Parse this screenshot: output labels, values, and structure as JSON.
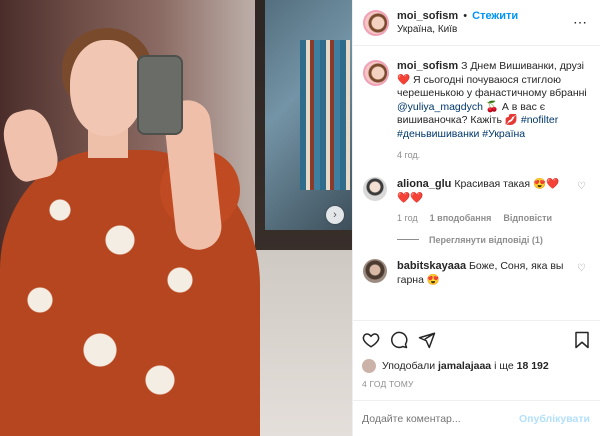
{
  "header": {
    "username": "moi_sofism",
    "separator": "•",
    "follow_label": "Стежити",
    "location": "Україна, Київ",
    "more_icon": "⋯"
  },
  "caption": {
    "username": "moi_sofism",
    "text_1": "З Днем Вишиванки, друзі",
    "text_2": "Я сьогодні почуваюся стиглою черешенькою у фанастичному вбранні",
    "mention": "@yuliya_magdych",
    "text_3": "А в вас є вишиваночка? Кажіть",
    "hashtags": "#nofilter #деньвишиванки #Україна",
    "time": "4 год."
  },
  "comments": [
    {
      "username": "aliona_glu",
      "text": "Красивая такая",
      "time": "1 год",
      "likes": "1 вподобання",
      "reply": "Відповісти",
      "view_replies": "Переглянути відповіді (1)"
    },
    {
      "username": "babitskayaaa",
      "text": "Боже, Соня, яка вы гарна"
    }
  ],
  "likes": {
    "prefix": "Уподобали",
    "user": "jamalajaaa",
    "suffix": "і ще",
    "count": "18 192"
  },
  "post_time": "4 ГОД ТОМУ",
  "add_comment": {
    "placeholder": "Додайте коментар...",
    "publish": "Опублікувати"
  },
  "colors": {
    "accent": "#0095f6",
    "link": "#00376b",
    "muted": "#8e8e8e",
    "publish_disabled": "#b2dffc"
  }
}
